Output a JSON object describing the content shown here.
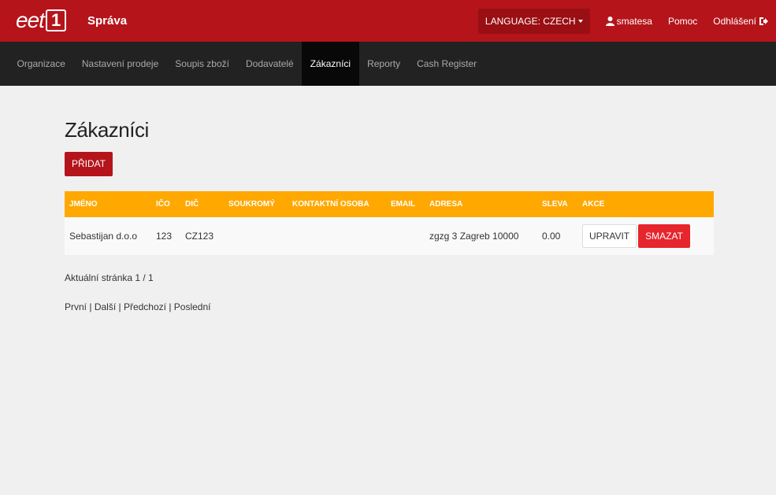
{
  "header": {
    "logo_text": "eet",
    "logo_number": "1",
    "title": "Správa",
    "language_label": "LANGUAGE: CZECH",
    "user": "smatesa",
    "help": "Pomoc",
    "logout": "Odhlášení"
  },
  "nav": {
    "items": [
      {
        "label": "Organizace"
      },
      {
        "label": "Nastavení prodeje"
      },
      {
        "label": "Soupis zboží"
      },
      {
        "label": "Dodavatelé"
      },
      {
        "label": "Zákazníci"
      },
      {
        "label": "Reporty"
      },
      {
        "label": "Cash Register"
      }
    ],
    "active": "Zákazníci"
  },
  "page": {
    "title": "Zákazníci",
    "add_label": "PŘIDAT"
  },
  "table": {
    "headers": [
      "JMÉNO",
      "IČO",
      "DIČ",
      "SOUKROMÝ",
      "KONTAKTNÍ OSOBA",
      "EMAIL",
      "ADRESA",
      "SLEVA",
      "AKCE"
    ],
    "rows": [
      {
        "name": "Sebastijan d.o.o",
        "ico": "123",
        "dic": "CZ123",
        "private": "",
        "contact": "",
        "email": "",
        "address": "zgzg 3 Zagreb 10000",
        "discount": "0.00",
        "edit_label": "UPRAVIT",
        "delete_label": "SMAZAT"
      }
    ]
  },
  "pagination": {
    "info": "Aktuální stránka 1 / 1",
    "first": "První",
    "next": "Další",
    "prev": "Předchozí",
    "last": "Poslední"
  },
  "colors": {
    "header_bg": "#b5141b",
    "nav_bg": "#222222",
    "table_header_bg": "#ffa800",
    "delete_bg": "#e6252c"
  }
}
